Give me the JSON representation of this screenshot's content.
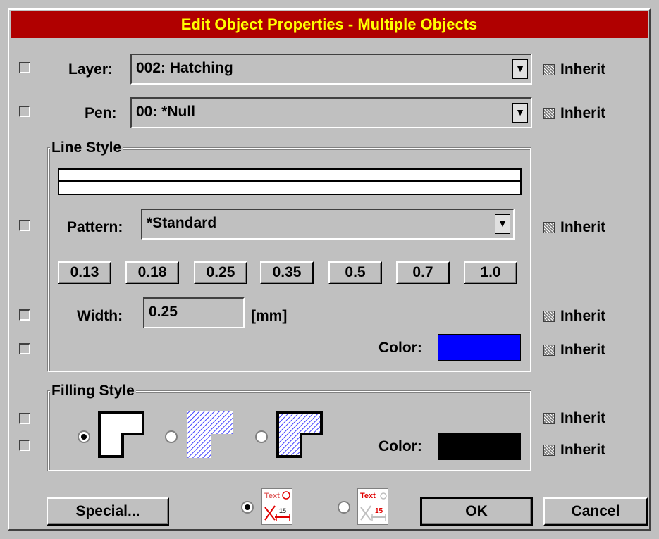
{
  "dialog": {
    "title": "Edit Object Properties - Multiple Objects"
  },
  "layer": {
    "label": "Layer:",
    "value": "002: Hatching"
  },
  "pen": {
    "label": "Pen:",
    "value": "00: *Null"
  },
  "inherit_label": "Inherit",
  "line_style": {
    "title": "Line Style",
    "pattern_label": "Pattern:",
    "pattern_value": "*Standard",
    "widths": [
      "0.13",
      "0.18",
      "0.25",
      "0.35",
      "0.5",
      "0.7",
      "1.0"
    ],
    "width_label": "Width:",
    "width_value": "0.25",
    "width_unit": "[mm]",
    "color_label": "Color:",
    "color_value": "#0000ff"
  },
  "filling_style": {
    "title": "Filling Style",
    "color_label": "Color:",
    "color_value": "#000000",
    "options": [
      "outline",
      "hatched",
      "hatched-outlined"
    ],
    "selected": "outline"
  },
  "buttons": {
    "special": "Special...",
    "ok": "OK",
    "cancel": "Cancel"
  },
  "text_mode": {
    "thumb_label": "Text",
    "dimension_value": "15",
    "selected_index": 0
  },
  "colors": {
    "title_bar": "#b00000",
    "title_text": "#ffff00"
  }
}
